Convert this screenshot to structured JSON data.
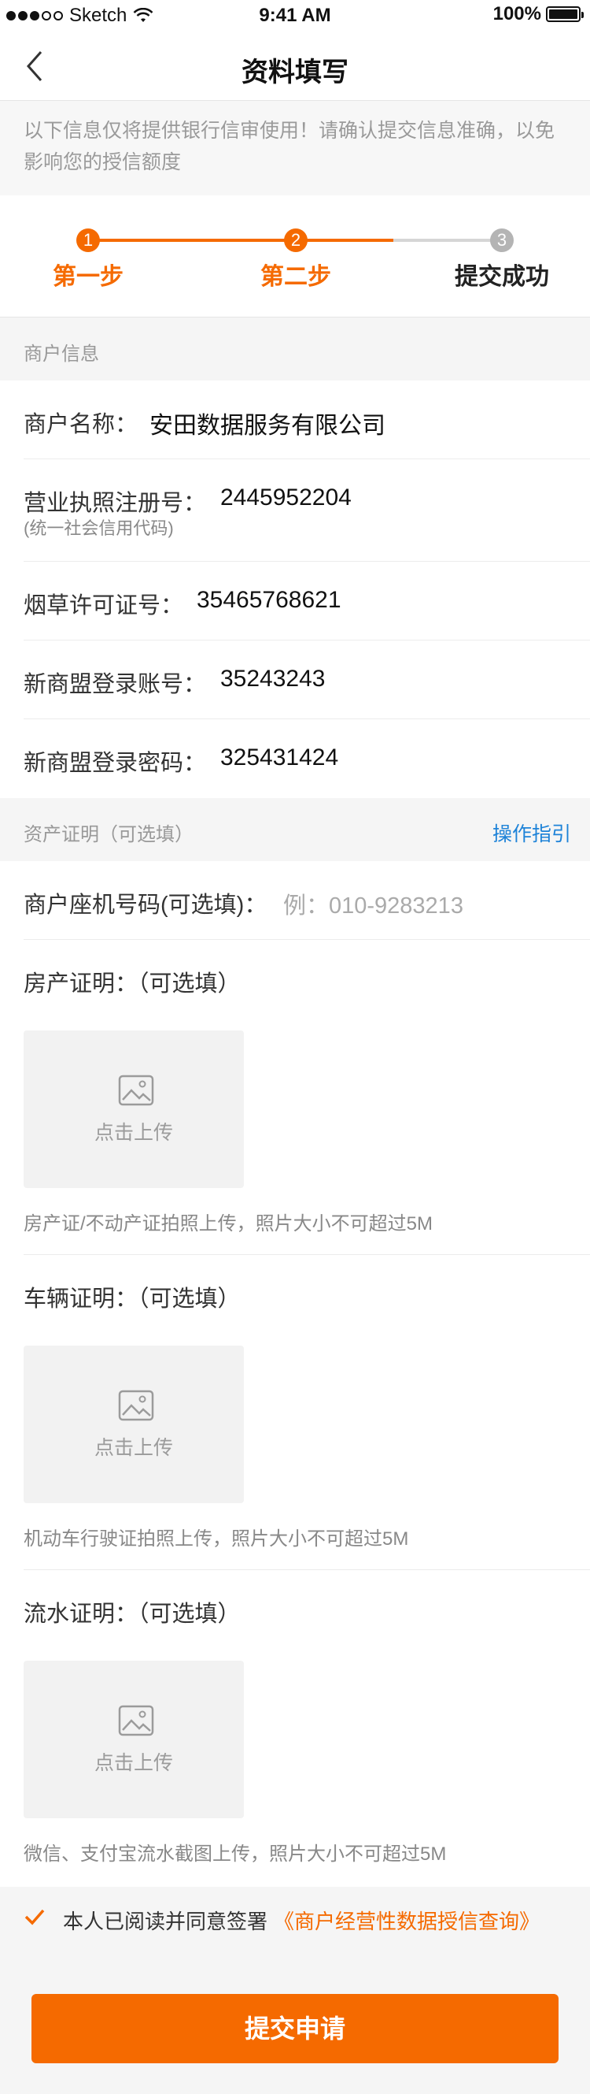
{
  "status_bar": {
    "carrier": "Sketch",
    "time": "9:41 AM",
    "battery": "100%"
  },
  "nav": {
    "title": "资料填写"
  },
  "notice": "以下信息仅将提供银行信审使用！请确认提交信息准确，以免影响您的授信额度",
  "steps": [
    {
      "num": "1",
      "label": "第一步",
      "state": "done"
    },
    {
      "num": "2",
      "label": "第二步",
      "state": "current"
    },
    {
      "num": "3",
      "label": "提交成功",
      "state": "pending"
    }
  ],
  "colors": {
    "accent": "#f56a00",
    "link": "#1e83d8",
    "pending": "#c8c8c8"
  },
  "merchant_section": {
    "title": "商户信息"
  },
  "merchant_info": [
    {
      "label": "商户名称：",
      "value": "安田数据服务有限公司"
    },
    {
      "label": "营业执照注册号：",
      "value": "2445952204",
      "sub": "(统一社会信用代码)"
    },
    {
      "label": "烟草许可证号：",
      "value": "35465768621"
    },
    {
      "label": "新商盟登录账号：",
      "value": "35243243"
    },
    {
      "label": "新商盟登录密码：",
      "value": "325431424"
    }
  ],
  "asset_section": {
    "title": "资产证明（可选填）",
    "guide_link": "操作指引"
  },
  "phone": {
    "label": "商户座机号码(可选填)：",
    "placeholder": "例：010-9283213"
  },
  "proofs": [
    {
      "label": "房产证明：（可选填）",
      "upload_text": "点击上传",
      "icon": "image-icon",
      "hint": "房产证/不动产证拍照上传，照片大小不可超过5M"
    },
    {
      "label": "车辆证明：（可选填）",
      "upload_text": "点击上传",
      "icon": "image-icon",
      "hint": "机动车行驶证拍照上传，照片大小不可超过5M"
    },
    {
      "label": "流水证明：（可选填）",
      "upload_text": "点击上传",
      "icon": "image-icon",
      "hint": "微信、支付宝流水截图上传，照片大小不可超过5M"
    }
  ],
  "agreement": {
    "text": "本人已阅读并同意签署",
    "link": "《商户经营性数据授信查询》",
    "checked": true
  },
  "submit": {
    "label": "提交申请"
  }
}
